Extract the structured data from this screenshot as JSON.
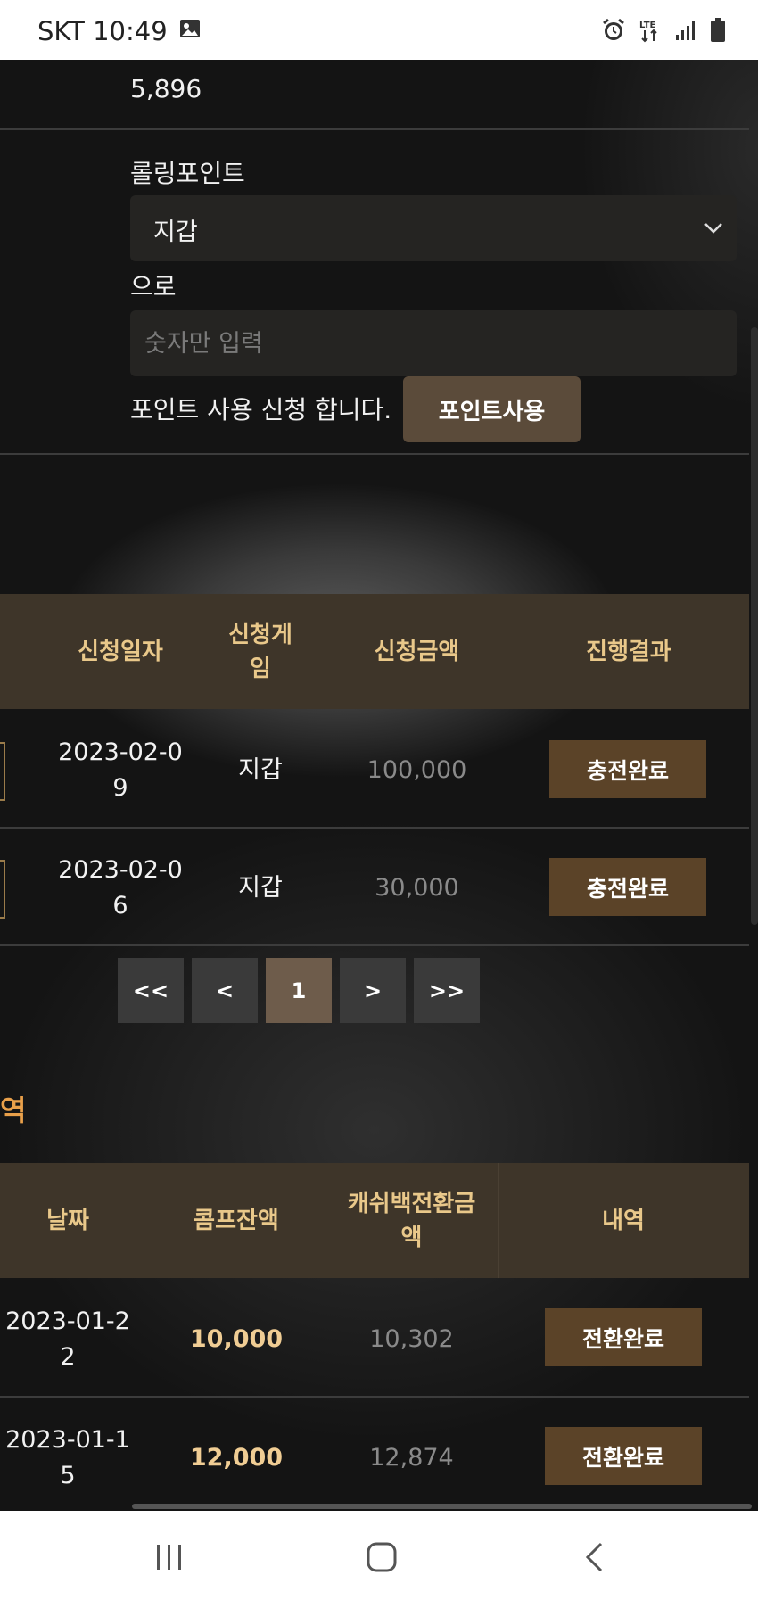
{
  "status_bar": {
    "carrier_time": "SKT 10:49",
    "icons": [
      "image-icon",
      "alarm-icon",
      "lte-icon",
      "signal-icon",
      "battery-icon"
    ]
  },
  "points": {
    "value": "5,896",
    "from_label": "롤링포인트",
    "selected_wallet": "지갑",
    "to_label": "으로",
    "amount_placeholder": "숫자만 입력",
    "apply_text": "포인트 사용 신청 합니다.",
    "apply_button": "포인트사용"
  },
  "request_table": {
    "headers": [
      "신청일자",
      "신청게임",
      "신청금액",
      "진행결과"
    ],
    "rows": [
      {
        "date": "2023-02-09",
        "game": "지갑",
        "amount": "100,000",
        "status": "충전완료"
      },
      {
        "date": "2023-02-06",
        "game": "지갑",
        "amount": "30,000",
        "status": "충전완료"
      }
    ]
  },
  "pagination": {
    "first": "<<",
    "prev": "<",
    "current": "1",
    "next": ">",
    "last": ">>"
  },
  "history": {
    "title_fragment": "역",
    "headers": [
      "날짜",
      "콤프잔액",
      "캐쉬백전환금액",
      "내역"
    ],
    "rows": [
      {
        "date": "2023-01-22",
        "comp": "10,000",
        "cash": "10,302",
        "status": "전환완료"
      },
      {
        "date": "2023-01-15",
        "comp": "12,000",
        "cash": "12,874",
        "status": "전환완료"
      }
    ]
  },
  "colors": {
    "accent_gold": "#e9c88a",
    "status_button": "#5b4328",
    "section_title": "#e9a04a"
  }
}
